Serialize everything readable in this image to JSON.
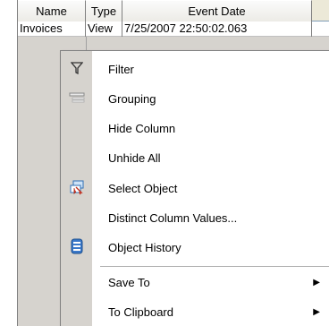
{
  "grid": {
    "columns": [
      "Name",
      "Type",
      "Event Date"
    ],
    "rows": [
      {
        "name": "Invoices",
        "type": "View",
        "event_date": "7/25/2007 22:50:02.063"
      }
    ]
  },
  "context_menu": {
    "items": [
      {
        "label": "Filter",
        "icon": "filter-funnel-icon"
      },
      {
        "label": "Grouping",
        "icon": "grouping-icon"
      },
      {
        "label": "Hide Column"
      },
      {
        "label": "Unhide All"
      },
      {
        "label": "Select Object",
        "icon": "select-object-icon"
      },
      {
        "label": "Distinct Column Values..."
      },
      {
        "label": "Object History",
        "icon": "object-history-icon"
      },
      {
        "label": "Save To",
        "submenu": true
      },
      {
        "label": "To Clipboard",
        "submenu": true
      }
    ],
    "submenu_arrow": "▶"
  },
  "colors": {
    "menu_gutter": "#d6d3ce",
    "grid_background": "#d6d3ce",
    "history_icon_blue": "#3a78c9"
  }
}
